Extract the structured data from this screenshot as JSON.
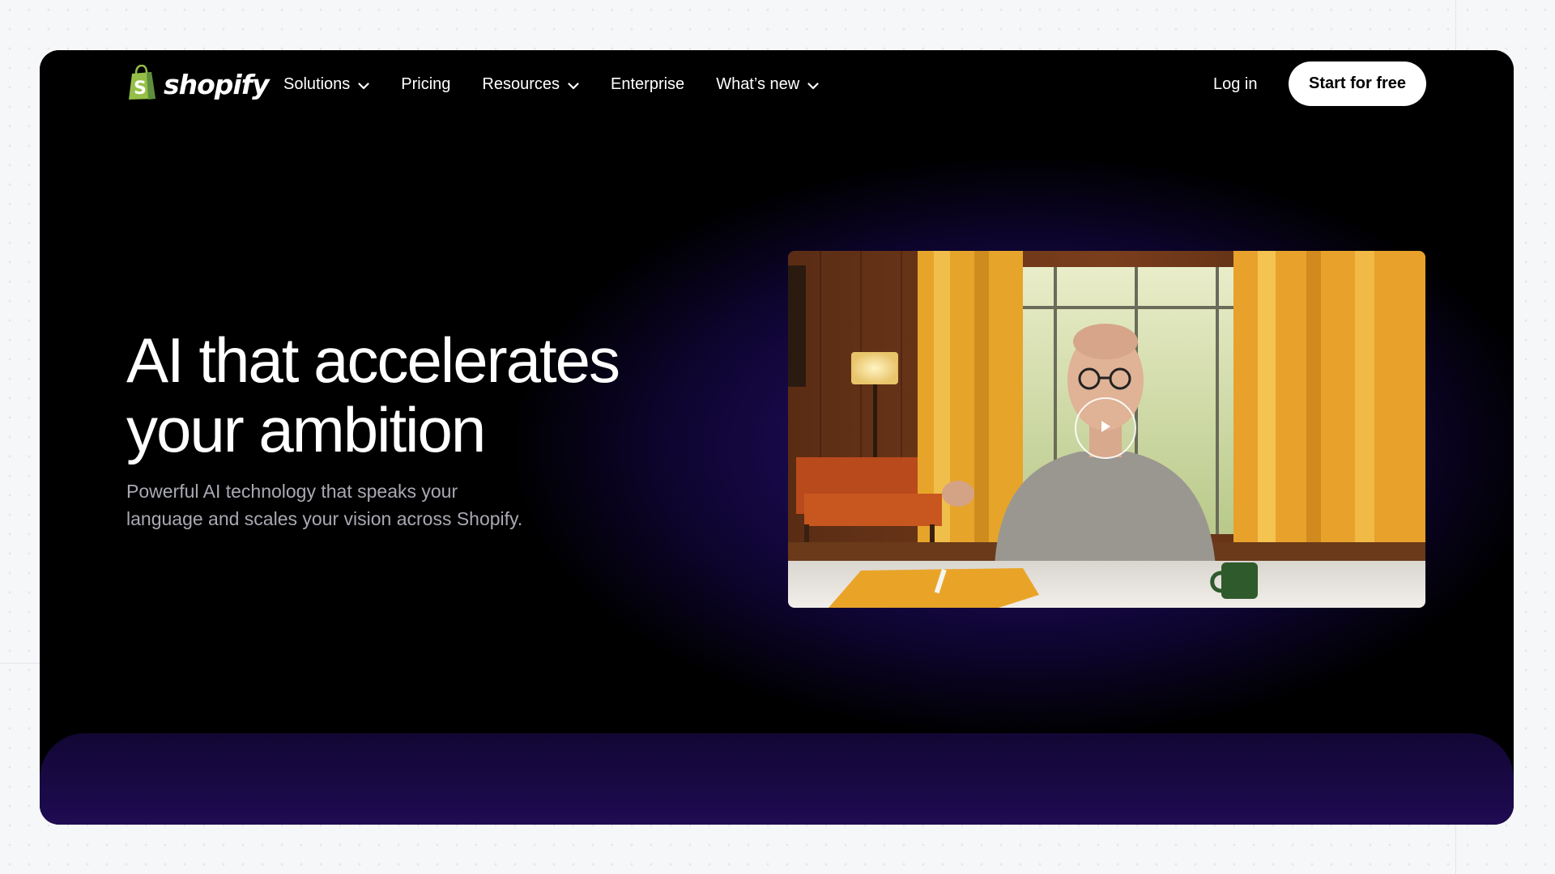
{
  "brand": {
    "name": "shopify",
    "logo_icon": "shopping-bag-icon",
    "logo_color": "#95bf47"
  },
  "nav": {
    "items": [
      {
        "label": "Solutions",
        "has_dropdown": true
      },
      {
        "label": "Pricing",
        "has_dropdown": false
      },
      {
        "label": "Resources",
        "has_dropdown": true
      },
      {
        "label": "Enterprise",
        "has_dropdown": false
      },
      {
        "label": "What’s new",
        "has_dropdown": true
      }
    ],
    "login_label": "Log in",
    "cta_label": "Start for free"
  },
  "hero": {
    "headline_line1": "AI that accelerates",
    "headline_line2": "your ambition",
    "subcopy_line1": "Powerful AI technology that speaks your",
    "subcopy_line2": "language and scales your vision across Shopify."
  },
  "video": {
    "play_icon": "play-icon"
  },
  "colors": {
    "background": "#000000",
    "accent_glow": "#2a0f72",
    "cta_background": "#ffffff",
    "subtext": "#a9a9b3"
  }
}
